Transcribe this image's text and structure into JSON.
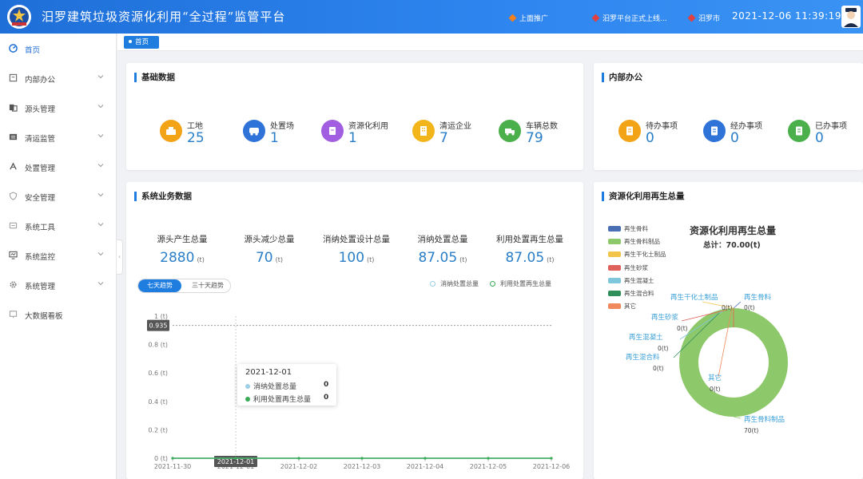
{
  "header": {
    "title": "汨罗建筑垃圾资源化利用“全过程”监管平台",
    "notices": [
      "上面推广",
      "汨罗平台正式上线...",
      "汨罗市"
    ],
    "datetime": "2021-12-06  11:39:19"
  },
  "sidebar": {
    "items": [
      {
        "label": "首页",
        "icon": "dashboard-icon",
        "active": true
      },
      {
        "label": "内部办公",
        "icon": "office-icon"
      },
      {
        "label": "源头管理",
        "icon": "source-icon"
      },
      {
        "label": "清运监管",
        "icon": "transport-icon"
      },
      {
        "label": "处置管理",
        "icon": "disposal-icon"
      },
      {
        "label": "安全管理",
        "icon": "shield-icon"
      },
      {
        "label": "系统工具",
        "icon": "tools-icon"
      },
      {
        "label": "系统监控",
        "icon": "monitor-icon"
      },
      {
        "label": "系统管理",
        "icon": "gear-icon"
      },
      {
        "label": "大数据看板",
        "icon": "board-icon"
      }
    ]
  },
  "breadcrumb": {
    "home": "首页"
  },
  "basic": {
    "title": "基础数据",
    "items": [
      {
        "label": "工地",
        "value": "25",
        "color": "#f3a316",
        "icon": "site-icon"
      },
      {
        "label": "处置场",
        "value": "1",
        "color": "#2f72d8",
        "icon": "truck-icon"
      },
      {
        "label": "资源化利用",
        "value": "1",
        "color": "#a25ee0",
        "icon": "recycle-icon"
      },
      {
        "label": "清运企业",
        "value": "7",
        "color": "#f3b51c",
        "icon": "building-icon"
      },
      {
        "label": "车辆总数",
        "value": "79",
        "color": "#4bb04c",
        "icon": "vehicle-icon"
      }
    ]
  },
  "office": {
    "title": "内部办公",
    "items": [
      {
        "label": "待办事项",
        "value": "0",
        "color": "#f3a316",
        "icon": "todo-icon"
      },
      {
        "label": "经办事项",
        "value": "0",
        "color": "#2f72d8",
        "icon": "handling-icon"
      },
      {
        "label": "已办事项",
        "value": "0",
        "color": "#4bb04c",
        "icon": "done-icon"
      }
    ]
  },
  "business": {
    "title": "系统业务数据",
    "metrics": [
      {
        "label": "源头产生总量",
        "value": "2880",
        "unit": "(t)"
      },
      {
        "label": "源头减少总量",
        "value": "70",
        "unit": "(t)"
      },
      {
        "label": "消纳处置设计总量",
        "value": "100",
        "unit": "(t)"
      },
      {
        "label": "消纳处置总量",
        "value": "87.05",
        "unit": "(t)"
      },
      {
        "label": "利用处置再生总量",
        "value": "87.05",
        "unit": "(t)"
      }
    ],
    "tabs": [
      "七天趋势",
      "三十天趋势"
    ],
    "legend": [
      "消纳处置总量",
      "利用处置再生总量"
    ],
    "tooltip": {
      "date": "2021-12-01",
      "rows": [
        {
          "label": "消纳处置总量",
          "value": "0"
        },
        {
          "label": "利用处置再生总量",
          "value": "0"
        }
      ]
    },
    "crosshair_y_label": "0.935",
    "crosshair_x_label": "2021-12-01"
  },
  "recycle": {
    "title": "资源化利用再生总量",
    "chart_title": "资源化利用再生总量",
    "total": "总计：70.00(t)"
  },
  "chart_data": [
    {
      "type": "line",
      "x": [
        "2021-11-30",
        "2021-12-01",
        "2021-12-02",
        "2021-12-03",
        "2021-12-04",
        "2021-12-05",
        "2021-12-06"
      ],
      "yticks": [
        "0 (t)",
        "0.2 (t)",
        "0.4 (t)",
        "0.6 (t)",
        "0.8 (t)",
        "1 (t)"
      ],
      "ylim": [
        0,
        1
      ],
      "series": [
        {
          "name": "消纳处置总量",
          "values": [
            0,
            0,
            0,
            0,
            0,
            0,
            0
          ],
          "color": "#9bd0e8"
        },
        {
          "name": "利用处置再生总量",
          "values": [
            0,
            0,
            0,
            0,
            0,
            0,
            0
          ],
          "color": "#3aaa55"
        }
      ],
      "legend": "top-right",
      "grid": false
    },
    {
      "type": "pie",
      "title": "资源化利用再生总量",
      "subtitle": "总计：70.00(t)",
      "labels": [
        "再生骨料",
        "再生骨料制品",
        "再生干化土制品",
        "再生砂浆",
        "再生混凝土",
        "再生混合料",
        "其它"
      ],
      "values": [
        0,
        70,
        0,
        0,
        0,
        0,
        0
      ],
      "value_labels": [
        "0(t)",
        "70(t)",
        "0(t)",
        "0(t)",
        "0(t)",
        "0(t)",
        "0(t)"
      ],
      "colors": [
        "#4a6fb5",
        "#8dc86a",
        "#f2c449",
        "#e0605a",
        "#7ec6dc",
        "#2f8f5a",
        "#f08a5d"
      ],
      "legend": "left"
    }
  ]
}
